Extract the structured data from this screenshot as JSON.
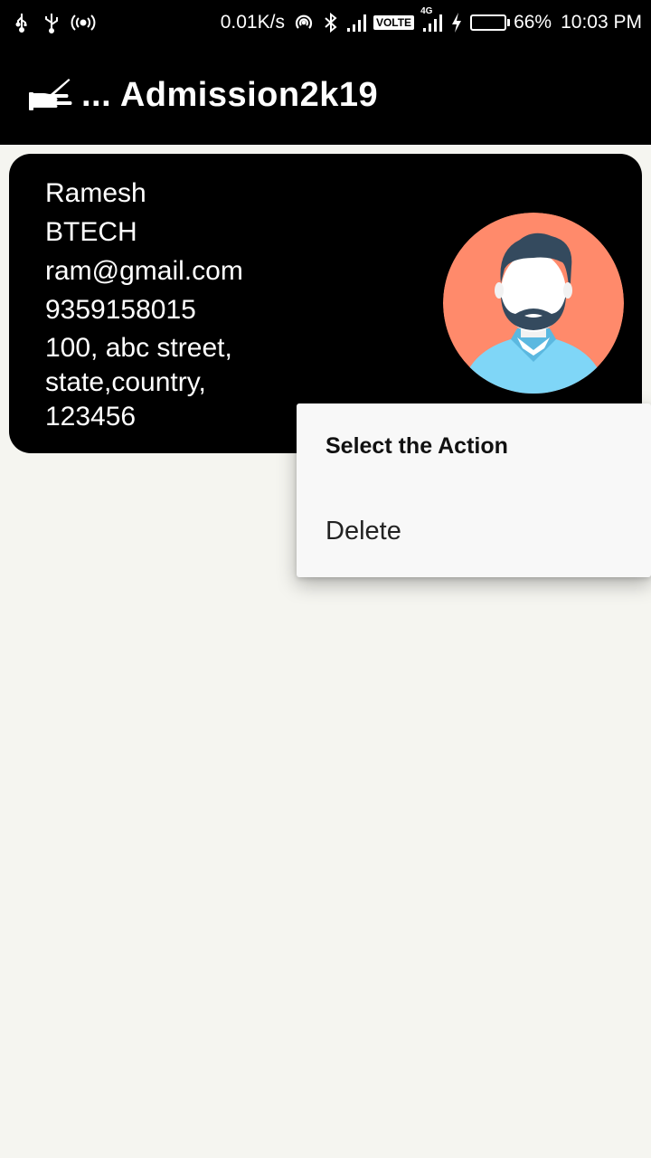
{
  "status_bar": {
    "net_speed": "0.01K/s",
    "volte_label": "VOLTE",
    "network_type": "4G",
    "battery_percent": "66%",
    "battery_level": 0.66,
    "time": "10:03 PM",
    "left_icons": [
      "usb-debug-icon",
      "usb-icon",
      "hotspot-icon"
    ],
    "right_icons": [
      "wifi-hotspot-icon",
      "bluetooth-icon",
      "signal-icon",
      "charging-icon"
    ]
  },
  "app_bar": {
    "title": "... Admission2k19",
    "logo_icon": "writing-hand-icon"
  },
  "card": {
    "name": "Ramesh",
    "course": "BTECH",
    "email": "ram@gmail.com",
    "phone": "9359158015",
    "address_line1": "100, abc street,",
    "address_line2": "state,country,",
    "address_line3": "123456",
    "avatar_icon": "male-avatar-icon",
    "avatar_bg": "#ff8a6b"
  },
  "context_menu": {
    "title": "Select the Action",
    "items": [
      "Delete"
    ]
  }
}
